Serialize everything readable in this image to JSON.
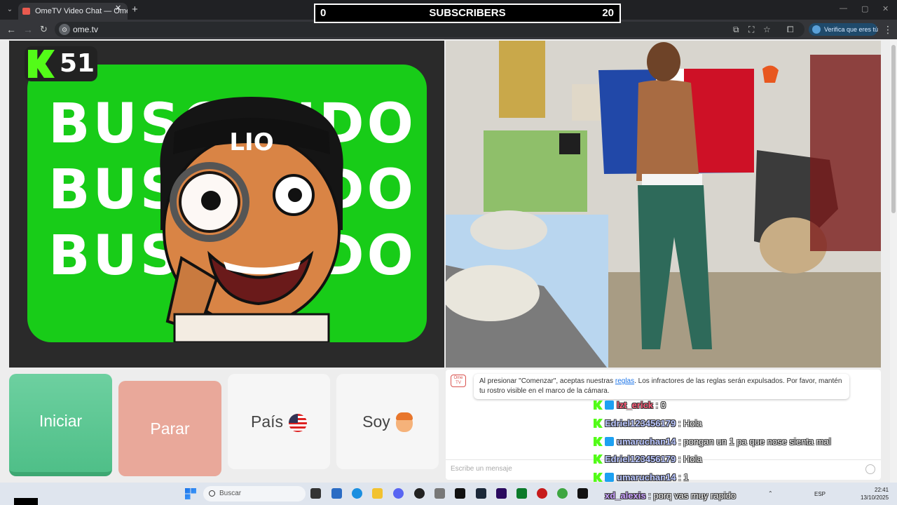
{
  "browser": {
    "tab_title": "OmeTV Video Chat — Ome",
    "url": "ome.tv",
    "verify_label": "Verifica que eres tú"
  },
  "stream_overlay": {
    "subs_left": "0",
    "subs_title": "SUBSCRIBERS",
    "subs_right": "20",
    "kick_count": "51"
  },
  "left_video": {
    "headband": "LIO",
    "lines": [
      "BUSCANDO",
      "BUSCANDO",
      "BUSCANDO"
    ]
  },
  "buttons": {
    "start": "Iniciar",
    "stop": "Parar",
    "country": "País",
    "me": "Soy"
  },
  "chat": {
    "ome_icon_text": "Ome TV",
    "notice_before": "Al presionar \"Comenzar\", aceptas nuestras ",
    "notice_link": "reglas",
    "notice_after": ". Los infractores de las reglas serán expulsados. Por favor, mantén tu rostro visible en el marco de la cámara.",
    "input_placeholder": "Escribe un mensaje"
  },
  "kick_chat": [
    {
      "user": "lzt_erick",
      "text": " : 0"
    },
    {
      "user": "Edriel123456179",
      "text": " : Hola"
    },
    {
      "user": "umaruchan14",
      "text": " : pongan un 1 pa que nose sienta mal"
    },
    {
      "user": "Edriel123456179",
      "text": " : Hola"
    },
    {
      "user": "umaruchan14",
      "text": " : 1"
    },
    {
      "user": "xd_alexis",
      "text": " : porq vas muy rapido"
    }
  ],
  "taskbar": {
    "search_label": "Buscar",
    "lang": "ESP",
    "time": "22:41",
    "date": "13/10/2025"
  },
  "colors": {
    "kick_green": "#53fc18",
    "start_green": "#4fbf88",
    "stop_red": "#e9a89a",
    "card_green": "#18cc18"
  }
}
